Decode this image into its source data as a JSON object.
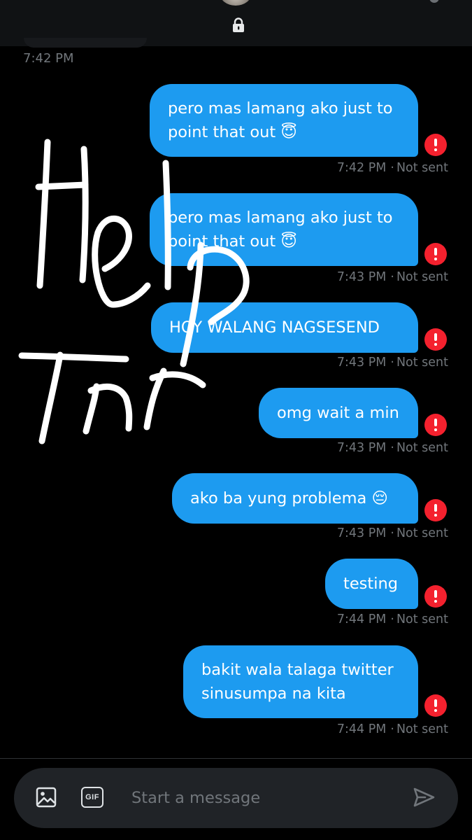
{
  "header": {
    "lock_icon": "lock-icon"
  },
  "earlier_message_time": "7:42 PM",
  "messages": [
    {
      "lines": [
        "pero mas lamang ako just to",
        "point that out 😇"
      ],
      "time": "7:42 PM",
      "status": "Not sent"
    },
    {
      "lines": [
        "pero mas lamang ako just to",
        "point that out 😇"
      ],
      "time": "7:43 PM",
      "status": "Not sent"
    },
    {
      "lines": [
        "HOY WALANG NAGSESEND"
      ],
      "time": "7:43 PM",
      "status": "Not sent"
    },
    {
      "lines": [
        "omg wait a min"
      ],
      "time": "7:43 PM",
      "status": "Not sent"
    },
    {
      "lines": [
        "ako ba yung problema 😔"
      ],
      "time": "7:43 PM",
      "status": "Not sent"
    },
    {
      "lines": [
        "testing"
      ],
      "time": "7:44 PM",
      "status": "Not sent"
    },
    {
      "lines": [
        "bakit wala talaga twitter",
        "sinusumpa na kita"
      ],
      "time": "7:44 PM",
      "status": "Not sent"
    }
  ],
  "meta_separator": "·",
  "composer": {
    "placeholder": "Start a message",
    "image_icon": "image-icon",
    "gif_label": "GIF",
    "send_icon": "send-icon"
  },
  "colors": {
    "bubble": "#1d9bf0",
    "error": "#f4212e",
    "muted": "#71767b",
    "background": "#000000"
  }
}
